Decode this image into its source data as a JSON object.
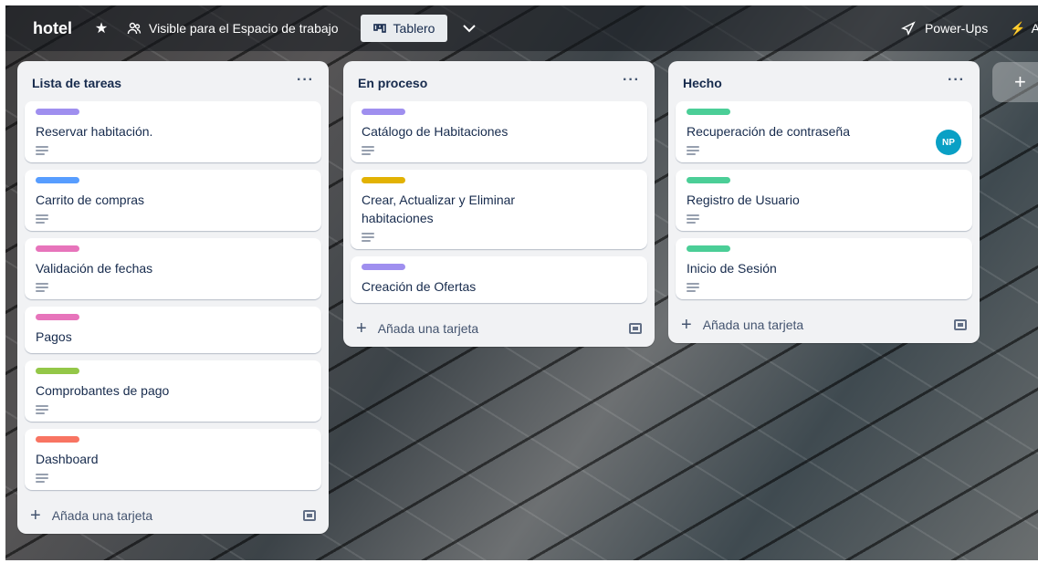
{
  "header": {
    "board_name": "hotel",
    "visibility": "Visible para el Espacio de trabajo",
    "view_label": "Tablero",
    "powerups_label": "Power-Ups",
    "automation_label": "A"
  },
  "lists": [
    {
      "title": "Lista de tareas",
      "menu": "···",
      "cards": [
        {
          "title": "Reservar habitación.",
          "label_color": "#9f8fef"
        },
        {
          "title": "Carrito de compras",
          "label_color": "#579dff"
        },
        {
          "title": "Validación de fechas",
          "label_color": "#e774bb"
        },
        {
          "title": "Pagos",
          "label_color": "#e774bb"
        },
        {
          "title": "Comprobantes de pago",
          "label_color": "#94c748"
        },
        {
          "title": "Dashboard",
          "label_color": "#f87462"
        }
      ],
      "add_label": "Añada una tarjeta"
    },
    {
      "title": "En proceso",
      "menu": "···",
      "cards": [
        {
          "title": "Catálogo de Habitaciones",
          "label_color": "#9f8fef"
        },
        {
          "title": "Crear, Actualizar y Eliminar habitaciones",
          "label_color": "#e2b203"
        },
        {
          "title": "Creación de Ofertas",
          "label_color": "#9f8fef"
        }
      ],
      "add_label": "Añada una tarjeta"
    },
    {
      "title": "Hecho",
      "menu": "···",
      "cards": [
        {
          "title": "Recuperación de contraseña",
          "label_color": "#4bce97",
          "avatar": "NP"
        },
        {
          "title": "Registro de Usuario",
          "label_color": "#4bce97"
        },
        {
          "title": "Inicio de Sesión",
          "label_color": "#4bce97"
        }
      ],
      "add_label": "Añada una tarjeta"
    }
  ],
  "add_list_label": "+"
}
